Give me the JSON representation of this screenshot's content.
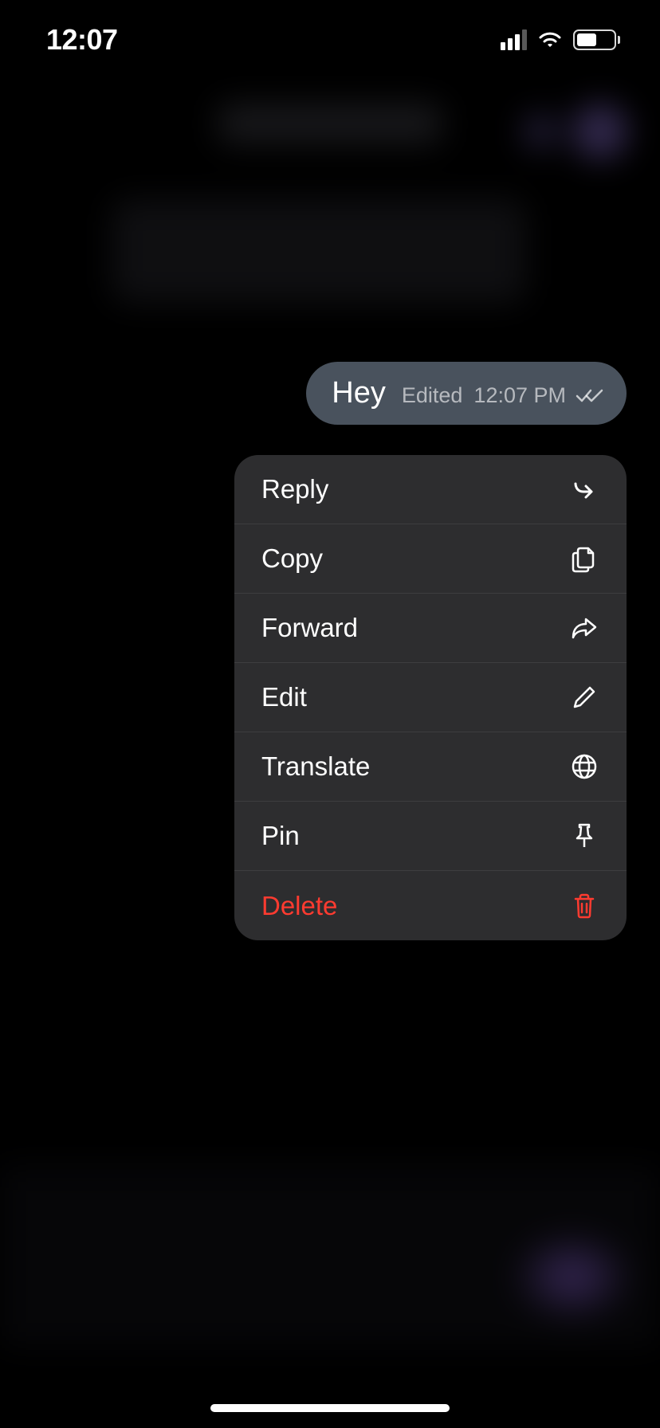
{
  "statusBar": {
    "time": "12:07"
  },
  "message": {
    "text": "Hey",
    "editedLabel": "Edited",
    "time": "12:07 PM"
  },
  "menu": {
    "items": [
      {
        "label": "Reply",
        "icon": "reply-arrow-icon",
        "danger": false
      },
      {
        "label": "Copy",
        "icon": "copy-icon",
        "danger": false
      },
      {
        "label": "Forward",
        "icon": "forward-arrow-icon",
        "danger": false
      },
      {
        "label": "Edit",
        "icon": "pencil-icon",
        "danger": false
      },
      {
        "label": "Translate",
        "icon": "globe-icon",
        "danger": false
      },
      {
        "label": "Pin",
        "icon": "pin-icon",
        "danger": false
      },
      {
        "label": "Delete",
        "icon": "trash-icon",
        "danger": true
      }
    ]
  }
}
